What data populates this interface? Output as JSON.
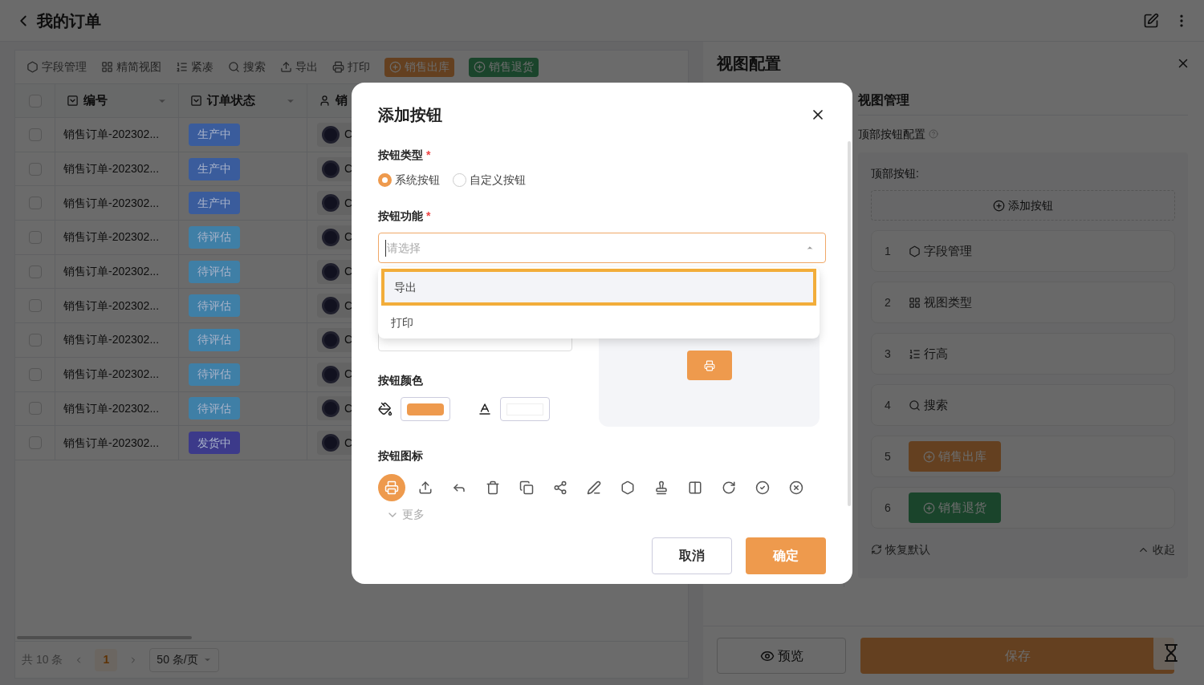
{
  "header": {
    "title": "我的订单"
  },
  "toolbar": [
    {
      "label": "字段管理",
      "kind": "plain"
    },
    {
      "label": "精简视图",
      "kind": "plain"
    },
    {
      "label": "紧凑",
      "kind": "plain"
    },
    {
      "label": "搜索",
      "kind": "plain"
    },
    {
      "label": "导出",
      "kind": "plain"
    },
    {
      "label": "打印",
      "kind": "plain"
    },
    {
      "label": "销售出库",
      "kind": "orange"
    },
    {
      "label": "销售退货",
      "kind": "green"
    }
  ],
  "table": {
    "header_checked": false,
    "columns": [
      "编号",
      "订单状态",
      "销"
    ],
    "rows": [
      {
        "order": "销售订单-202302...",
        "status": "生产中",
        "color": "#3a5c9c",
        "checked": false,
        "column_3": "C"
      },
      {
        "order": "销售订单-202302...",
        "status": "生产中",
        "color": "#3a5c9c",
        "checked": false,
        "column_3": "C"
      },
      {
        "order": "销售订单-202302...",
        "status": "生产中",
        "color": "#3a5c9c",
        "checked": false,
        "column_3": "C"
      },
      {
        "order": "销售订单-202302...",
        "status": "待评估",
        "color": "#3f7fa6",
        "checked": false,
        "column_3": "C"
      },
      {
        "order": "销售订单-202302...",
        "status": "待评估",
        "color": "#3f7fa6",
        "checked": false,
        "column_3": "C"
      },
      {
        "order": "销售订单-202302...",
        "status": "待评估",
        "color": "#3f7fa6",
        "checked": false,
        "column_3": "C"
      },
      {
        "order": "销售订单-202302...",
        "status": "待评估",
        "color": "#3f7fa6",
        "checked": false,
        "column_3": "C"
      },
      {
        "order": "销售订单-202302...",
        "status": "待评估",
        "color": "#3f7fa6",
        "checked": false,
        "column_3": "C"
      },
      {
        "order": "销售订单-202302...",
        "status": "待评估",
        "color": "#3f7fa6",
        "checked": false,
        "column_3": "C"
      },
      {
        "order": "销售订单-202302...",
        "status": "发货中",
        "color": "#3c3a8a",
        "checked": false,
        "column_3": "C"
      }
    ]
  },
  "pagination": {
    "total": "共 10 条",
    "page": "1",
    "per_page": "50 条/页"
  },
  "drawer": {
    "title": "视图配置",
    "section": "视图管理",
    "subsection": "顶部按钮配置",
    "label": "顶部按钮:",
    "add": "添加按钮",
    "items": [
      {
        "index": "1",
        "label": "字段管理",
        "kind": "plain"
      },
      {
        "index": "2",
        "label": "视图类型",
        "kind": "plain"
      },
      {
        "index": "3",
        "label": "行高",
        "kind": "plain"
      },
      {
        "index": "4",
        "label": "搜索",
        "kind": "plain"
      },
      {
        "index": "5",
        "label": "销售出库",
        "kind": "orange"
      },
      {
        "index": "6",
        "label": "销售退货",
        "kind": "green"
      }
    ],
    "restore": "恢复默认",
    "collapse": "收起",
    "preview": "预览",
    "save": "保存"
  },
  "modal": {
    "title": "添加按钮",
    "type_label": "按钮类型",
    "radios": [
      {
        "label": "系统按钮",
        "selected": true
      },
      {
        "label": "自定义按钮",
        "selected": false
      }
    ],
    "function_label": "按钮功能",
    "placeholder": "请选择",
    "options": [
      {
        "label": "导出",
        "selected": true
      },
      {
        "label": "打印",
        "selected": false
      }
    ],
    "type_required": "*",
    "function_required": "*",
    "color_label": "按钮颜色",
    "icon_label": "按钮图标",
    "icons": [
      {
        "selected": true
      },
      {
        "selected": false
      },
      {
        "selected": false
      },
      {
        "selected": false
      },
      {
        "selected": false
      },
      {
        "selected": false
      },
      {
        "selected": false
      },
      {
        "selected": false
      },
      {
        "selected": false
      },
      {
        "selected": false
      },
      {
        "selected": false
      },
      {
        "selected": false
      },
      {
        "selected": false
      }
    ],
    "more": "更多",
    "cancel": "取消",
    "ok": "确定"
  }
}
